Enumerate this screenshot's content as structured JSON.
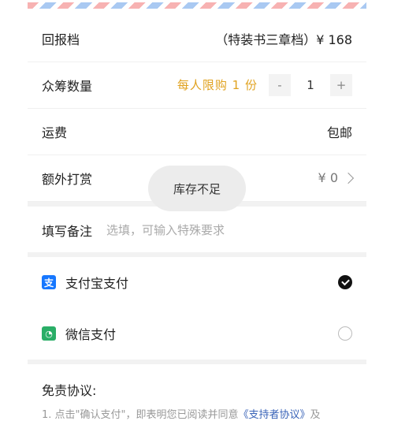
{
  "reward": {
    "label": "回报档",
    "value": "（特装书三章档）¥ 168"
  },
  "crowdfund_qty": {
    "label": "众筹数量",
    "limit_text": "每人限购 1 份",
    "minus": "-",
    "quantity": "1",
    "plus": "+"
  },
  "shipping": {
    "label": "运费",
    "value": "包邮"
  },
  "extra_tip": {
    "label": "额外打赏",
    "value": "¥ 0"
  },
  "remark": {
    "label": "填写备注",
    "placeholder": "选填，可输入特殊要求"
  },
  "payment": {
    "alipay": {
      "label": "支付宝支付",
      "icon_char": "支",
      "selected": true
    },
    "wechat": {
      "label": "微信支付",
      "icon_char": "◔",
      "selected": false
    }
  },
  "disclaimer": {
    "title": "免责协议:",
    "text_prefix": "1. 点击\"确认支付\"，即表明您已阅读并同意",
    "link": "《支持者协议》",
    "text_suffix": "及"
  },
  "toast": {
    "text": "库存不足"
  },
  "colors": {
    "accent_gold": "#e0a21f",
    "alipay_blue": "#1677ff",
    "wechat_green": "#2aae67",
    "link_blue": "#3a64b8"
  }
}
